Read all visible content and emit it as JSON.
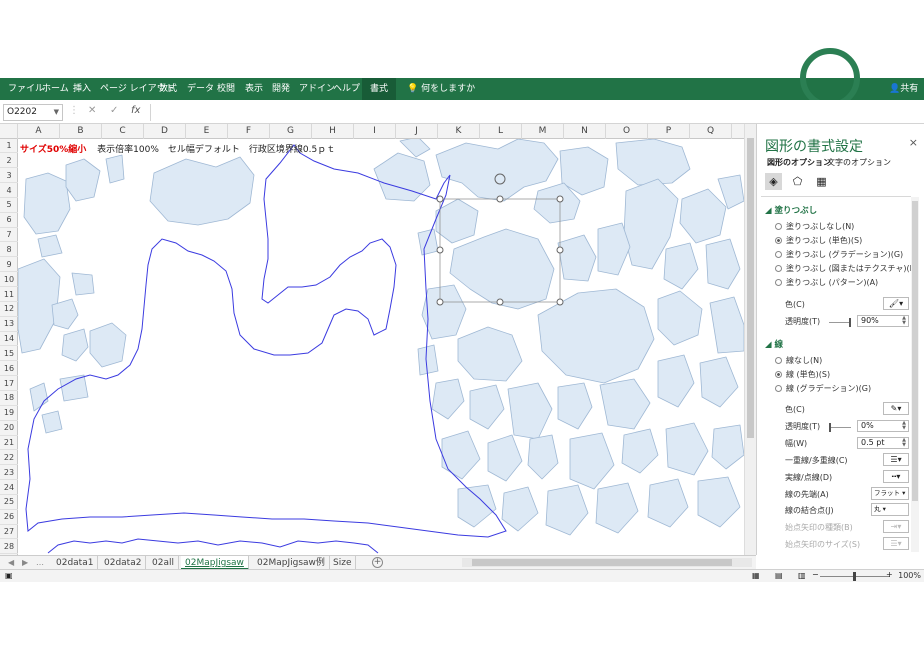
{
  "ribbon": {
    "tabs": [
      "ファイル",
      "ホーム",
      "挿入",
      "ページ レイアウト",
      "数式",
      "データ",
      "校閲",
      "表示",
      "開発",
      "アドイン",
      "ヘルプ",
      "書式"
    ],
    "active_tab": "書式",
    "tell_me": "何をしますか",
    "share": "共有",
    "bg_color": "#217346"
  },
  "formula_bar": {
    "name_box": "O2202",
    "fx": "fx",
    "cancel": "✕",
    "enter": "✓",
    "content": ""
  },
  "grid": {
    "columns": [
      "A",
      "B",
      "C",
      "D",
      "E",
      "F",
      "G",
      "H",
      "I",
      "J",
      "K",
      "L",
      "M",
      "N",
      "O",
      "P",
      "Q"
    ],
    "rows": [
      "1",
      "2",
      "3",
      "4",
      "5",
      "6",
      "7",
      "8",
      "9",
      "10",
      "11",
      "12",
      "13",
      "14",
      "15",
      "16",
      "17",
      "18",
      "19",
      "20",
      "21",
      "22",
      "23",
      "24",
      "25",
      "26",
      "27",
      "28"
    ],
    "row1": {
      "red_text": "サイズ50%縮小",
      "rest_text": "表示倍率100%　セル幅デフォルト　行政区境界線0.5ｐｔ"
    },
    "map_fill": "#dde9f5",
    "map_stroke": "#9fb8d4",
    "outline_color": "#3b3be0"
  },
  "sheet_tabs": {
    "tabs": [
      "02data1",
      "02data2",
      "02all",
      "02MapJigsaw",
      "02MapJigsaw例",
      "Size"
    ],
    "active": "02MapJigsaw",
    "add": "+"
  },
  "status": {
    "zoom": "100%"
  },
  "pane": {
    "title": "図形の書式設定",
    "close": "×",
    "tab_shape": "図形のオプション",
    "tab_text": "文字のオプション",
    "fill": {
      "header": "塗りつぶし",
      "options": [
        "塗りつぶしなし(N)",
        "塗りつぶし (単色)(S)",
        "塗りつぶし (グラデーション)(G)",
        "塗りつぶし (図またはテクスチャ)(P)",
        "塗りつぶし (パターン)(A)"
      ],
      "selected": 1,
      "color_label": "色(C)",
      "transparency_label": "透明度(T)",
      "transparency_value": "90%"
    },
    "line": {
      "header": "線",
      "options": [
        "線なし(N)",
        "線 (単色)(S)",
        "線 (グラデーション)(G)"
      ],
      "selected": 1,
      "color_label": "色(C)",
      "transparency_label": "透明度(T)",
      "transparency_value": "0%",
      "width_label": "幅(W)",
      "width_value": "0.5 pt",
      "compound_label": "一重線/多重線(C)",
      "dash_label": "実線/点線(D)",
      "cap_label": "線の先端(A)",
      "cap_value": "フラット",
      "join_label": "線の結合点(J)",
      "join_value": "丸",
      "arrow_type_label": "始点矢印の種類(B)",
      "arrow_size_label": "始点矢印のサイズ(S)"
    }
  }
}
